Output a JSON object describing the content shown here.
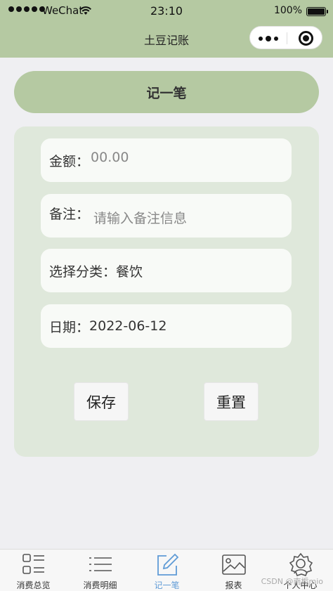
{
  "status_bar": {
    "carrier": "WeChat",
    "time": "23:10",
    "battery": "100%"
  },
  "nav": {
    "title": "土豆记账"
  },
  "header": {
    "title": "记一笔"
  },
  "form": {
    "amount_label": "金额：",
    "amount_placeholder": "00.00",
    "note_label": "备注：",
    "note_placeholder": "请输入备注信息",
    "category_label": "选择分类：",
    "category_value": "餐饮",
    "date_label": "日期：",
    "date_value": "2022-06-12",
    "save_label": "保存",
    "reset_label": "重置"
  },
  "tabbar": {
    "tabs": [
      {
        "label": "消费总览",
        "icon": "grid-list-icon"
      },
      {
        "label": "消费明细",
        "icon": "list-icon"
      },
      {
        "label": "记一笔",
        "icon": "edit-icon",
        "active": true
      },
      {
        "label": "报表",
        "icon": "image-icon"
      },
      {
        "label": "个人中心",
        "icon": "avatar-icon"
      }
    ],
    "active_color": "#5f9bd6"
  },
  "watermark": "CSDN @南栀mio",
  "colors": {
    "theme_green": "#b5c9a2",
    "card_green": "#dfe8db"
  }
}
